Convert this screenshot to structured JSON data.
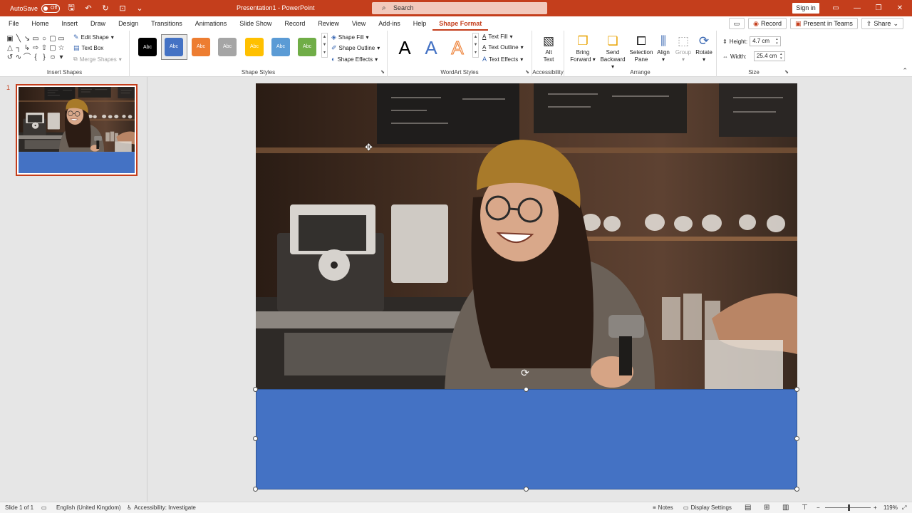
{
  "titlebar": {
    "autosave_label": "AutoSave",
    "autosave_state": "Off",
    "document_title": "Presentation1 - PowerPoint",
    "search_placeholder": "Search",
    "signin_label": "Sign in"
  },
  "menu": {
    "tabs": [
      "File",
      "Home",
      "Insert",
      "Draw",
      "Design",
      "Transitions",
      "Animations",
      "Slide Show",
      "Record",
      "Review",
      "View",
      "Add-ins",
      "Help",
      "Shape Format"
    ],
    "active_tab": "Shape Format",
    "record_label": "Record",
    "present_label": "Present in Teams",
    "share_label": "Share"
  },
  "ribbon": {
    "insert_shapes": {
      "label": "Insert Shapes",
      "edit_shape": "Edit Shape",
      "text_box": "Text Box",
      "merge_shapes": "Merge Shapes"
    },
    "shape_styles": {
      "label": "Shape Styles",
      "swatch_text": "Abc",
      "swatch_colors": [
        "#000000",
        "#4472c4",
        "#ed7d31",
        "#a5a5a5",
        "#ffc000",
        "#5b9bd5",
        "#70ad47"
      ],
      "shape_fill": "Shape Fill",
      "shape_outline": "Shape Outline",
      "shape_effects": "Shape Effects"
    },
    "wordart_styles": {
      "label": "WordArt Styles",
      "letter": "A",
      "text_fill": "Text Fill",
      "text_outline": "Text Outline",
      "text_effects": "Text Effects"
    },
    "accessibility": {
      "label": "Accessibility",
      "alt_text_line1": "Alt",
      "alt_text_line2": "Text"
    },
    "arrange": {
      "label": "Arrange",
      "bring_forward_1": "Bring",
      "bring_forward_2": "Forward",
      "send_backward_1": "Send",
      "send_backward_2": "Backward",
      "selection_pane_1": "Selection",
      "selection_pane_2": "Pane",
      "align": "Align",
      "group": "Group",
      "rotate": "Rotate"
    },
    "size": {
      "label": "Size",
      "height_label": "Height:",
      "height_value": "4.7 cm",
      "width_label": "Width:",
      "width_value": "25.4 cm"
    }
  },
  "slides_panel": {
    "slide_number": "1"
  },
  "status": {
    "slide_info": "Slide 1 of 1",
    "language": "English (United Kingdom)",
    "accessibility": "Accessibility: Investigate",
    "notes": "Notes",
    "display_settings": "Display Settings",
    "zoom": "119%"
  },
  "colors": {
    "accent": "#c43e1c",
    "shape_fill": "#4472c4"
  }
}
